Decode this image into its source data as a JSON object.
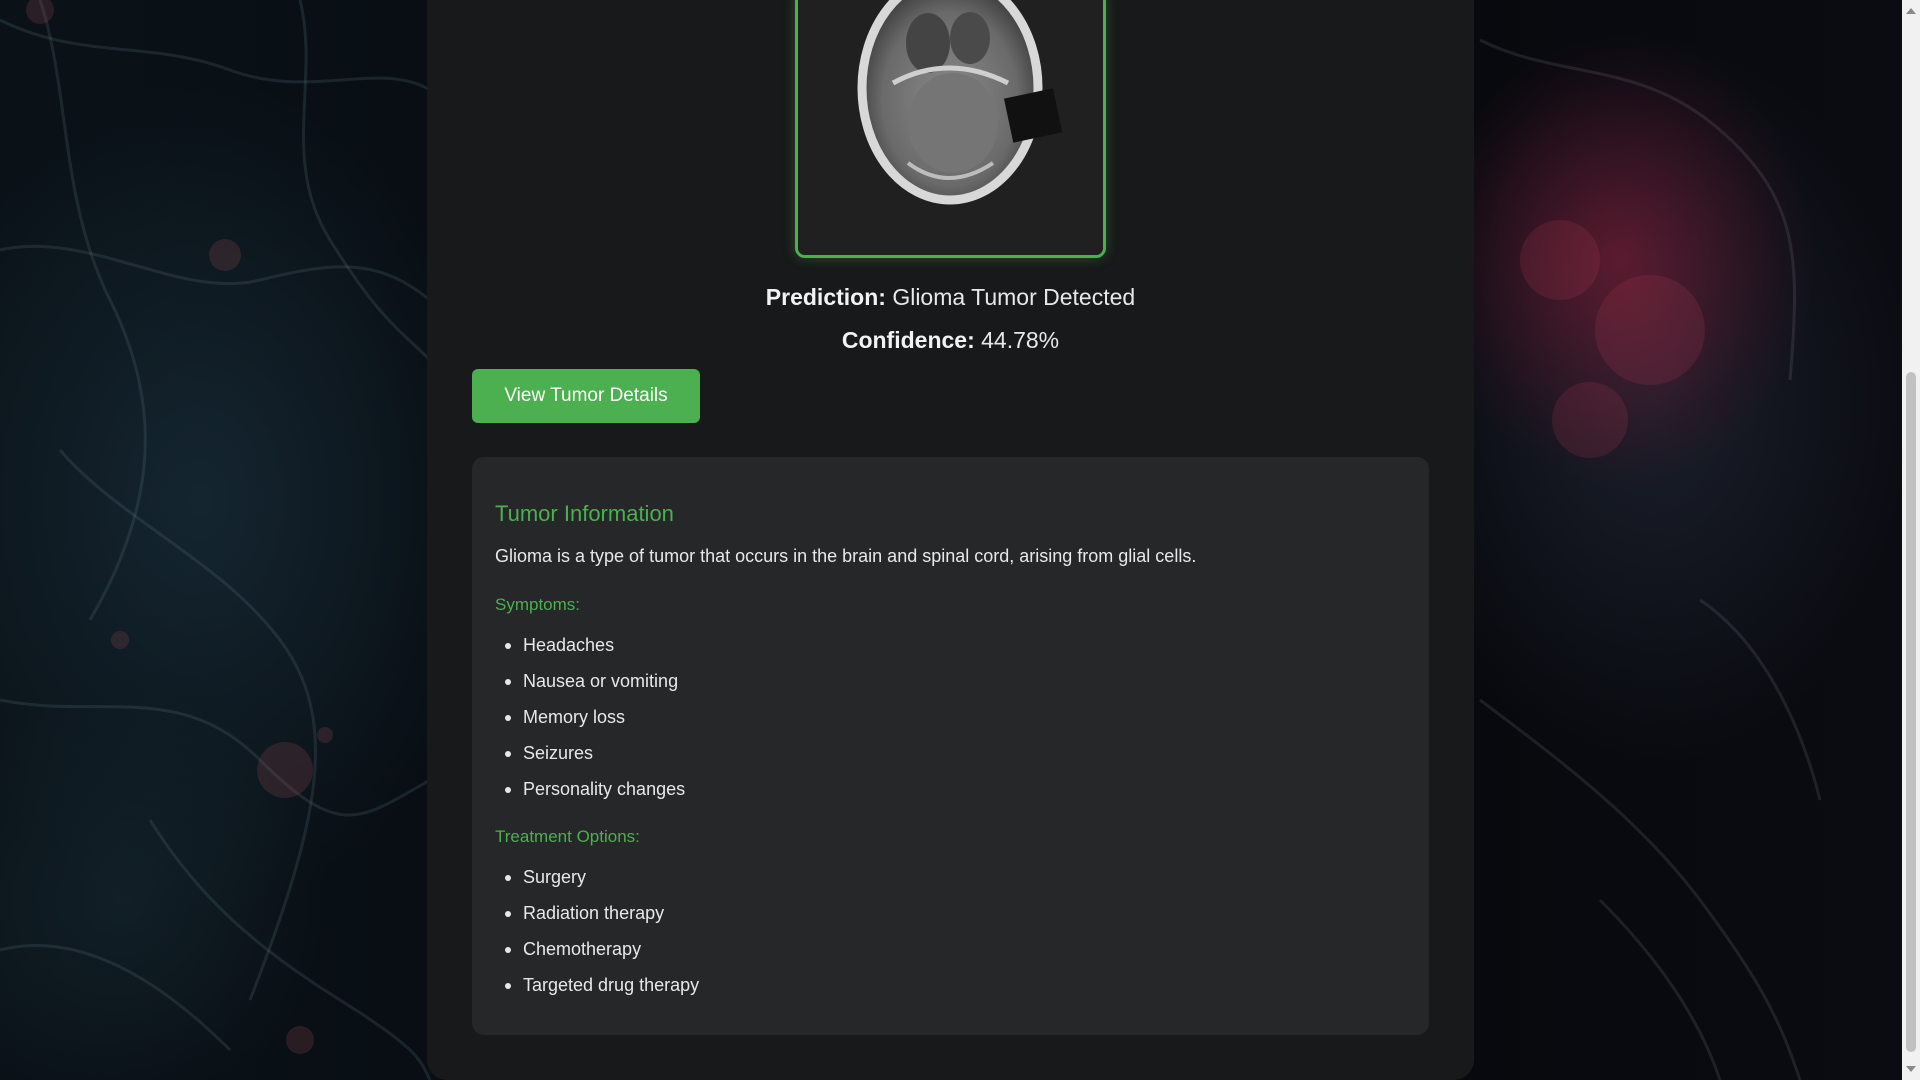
{
  "result": {
    "prediction_label": "Prediction:",
    "prediction_value": "Glioma Tumor Detected",
    "confidence_label": "Confidence:",
    "confidence_value": "44.78%"
  },
  "details_button": {
    "label": "View Tumor Details"
  },
  "tumor_info": {
    "title": "Tumor Information",
    "description": "Glioma is a type of tumor that occurs in the brain and spinal cord, arising from glial cells.",
    "symptoms_heading": "Symptoms:",
    "symptoms": [
      "Headaches",
      "Nausea or vomiting",
      "Memory loss",
      "Seizures",
      "Personality changes"
    ],
    "treatment_heading": "Treatment Options:",
    "treatments": [
      "Surgery",
      "Radiation therapy",
      "Chemotherapy",
      "Targeted drug therapy"
    ]
  },
  "icons": {
    "scroll_up": "chevron-up-icon",
    "scroll_down": "chevron-down-icon"
  },
  "colors": {
    "accent": "#4caf50",
    "panel": "#191a1b",
    "card": "#262728"
  }
}
